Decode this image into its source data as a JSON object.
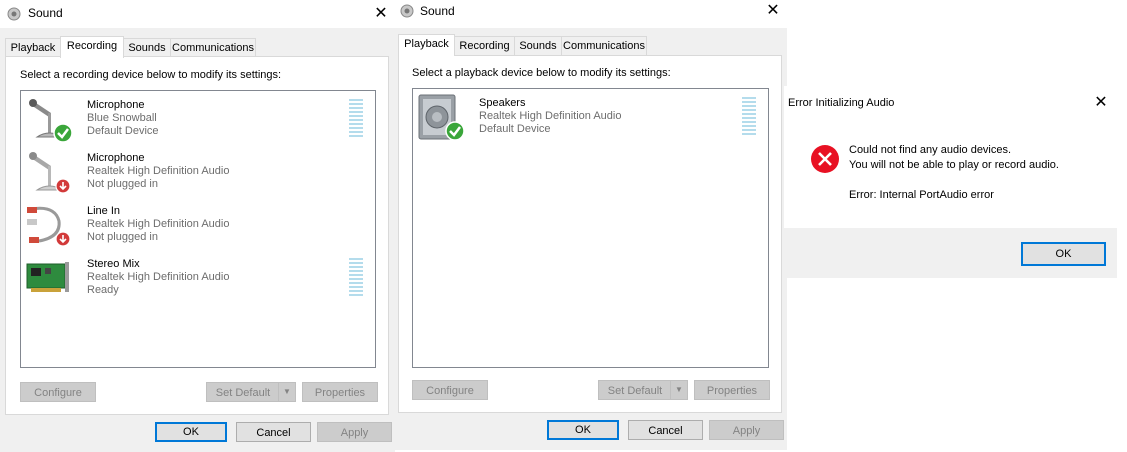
{
  "recording_window": {
    "title": "Sound",
    "close_glyph": "✕",
    "tabs": [
      {
        "label": "Playback",
        "active": false
      },
      {
        "label": "Recording",
        "active": true
      },
      {
        "label": "Sounds",
        "active": false
      },
      {
        "label": "Communications",
        "active": false
      }
    ],
    "instruction": "Select a recording device below to modify its settings:",
    "devices": [
      {
        "name": "Microphone",
        "line1": "Blue Snowball",
        "line2": "Default Device",
        "icon": "microphone-icon",
        "status_icon": "default-check-icon",
        "has_meter": true
      },
      {
        "name": "Microphone",
        "line1": "Realtek High Definition Audio",
        "line2": "Not plugged in",
        "icon": "microphone-icon",
        "status_icon": "unplugged-icon",
        "has_meter": false
      },
      {
        "name": "Line In",
        "line1": "Realtek High Definition Audio",
        "line2": "Not plugged in",
        "icon": "line-in-cable-icon",
        "status_icon": "unplugged-icon",
        "has_meter": false
      },
      {
        "name": "Stereo Mix",
        "line1": "Realtek High Definition Audio",
        "line2": "Ready",
        "icon": "sound-card-icon",
        "status_icon": "",
        "has_meter": true
      }
    ],
    "buttons": {
      "configure": "Configure",
      "set_default": "Set Default",
      "properties": "Properties",
      "ok": "OK",
      "cancel": "Cancel",
      "apply": "Apply"
    }
  },
  "playback_window": {
    "title": "Sound",
    "close_glyph": "✕",
    "tabs": [
      {
        "label": "Playback",
        "active": true
      },
      {
        "label": "Recording",
        "active": false
      },
      {
        "label": "Sounds",
        "active": false
      },
      {
        "label": "Communications",
        "active": false
      }
    ],
    "instruction": "Select a playback device below to modify its settings:",
    "devices": [
      {
        "name": "Speakers",
        "line1": "Realtek High Definition Audio",
        "line2": "Default Device",
        "icon": "speaker-icon",
        "status_icon": "default-check-icon",
        "has_meter": true
      }
    ],
    "buttons": {
      "configure": "Configure",
      "set_default": "Set Default",
      "properties": "Properties",
      "ok": "OK",
      "cancel": "Cancel",
      "apply": "Apply"
    }
  },
  "error_dialog": {
    "title": "Error Initializing Audio",
    "close_glyph": "✕",
    "icon": "error-icon",
    "message_line1": "Could not find any audio devices.",
    "message_line2": "You will not be able to play or record audio.",
    "detail": "Error: Internal PortAudio error",
    "ok": "OK"
  },
  "colors": {
    "accent_blue": "#0078d7",
    "error_red": "#e81123",
    "check_green": "#3aa63a",
    "meter_blue": "#b4dcec"
  }
}
